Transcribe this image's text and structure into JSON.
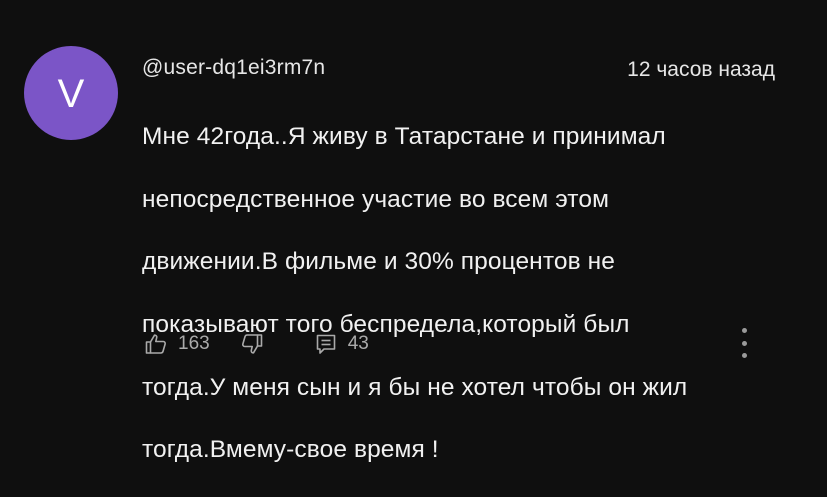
{
  "comment": {
    "avatar_letter": "V",
    "avatar_color": "#7b55c7",
    "author": "@user-dq1ei3rm7n",
    "timestamp": "12 часов назад",
    "text_lines": [
      "Мне 42года..Я живу в Татарстане и принимал",
      "непосредственное участие во всем этом",
      "движении.В фильме и 30% процентов не",
      "показывают того беспредела,который был",
      "тогда.У меня сын и я бы не хотел чтобы он жил",
      "тогда.Вмему-свое время !"
    ],
    "like_count": "163",
    "reply_count": "43"
  },
  "icons": {
    "like": "thumbs-up-icon",
    "dislike": "thumbs-down-icon",
    "reply": "reply-icon",
    "more": "more-vertical-icon"
  }
}
